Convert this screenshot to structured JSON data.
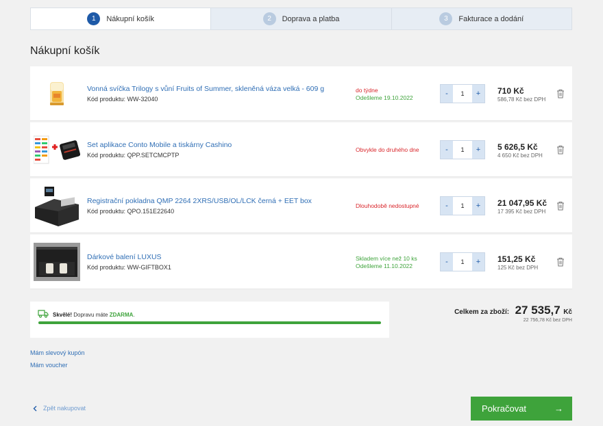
{
  "steps": [
    {
      "num": "1",
      "label": "Nákupní košík"
    },
    {
      "num": "2",
      "label": "Doprava a platba"
    },
    {
      "num": "3",
      "label": "Fakturace a dodání"
    }
  ],
  "page_title": "Nákupní košík",
  "items": [
    {
      "name": "Vonná svíčka Trilogy s vůní Fruits of Summer, skleněná váza velká - 609 g",
      "code": "Kód produktu: WW-32040",
      "avail_1": "do týdne",
      "avail_2": "Odešleme 19.10.2022",
      "qty": "1",
      "price": "710 Kč",
      "price_sub": "586,78 Kč bez DPH"
    },
    {
      "name": "Set aplikace Conto Mobile a tiskárny Cashino",
      "code": "Kód produktu: QPP.SETCMCPTP",
      "avail_1": "Obvykle do druhého dne",
      "qty": "1",
      "price": "5 626,5 Kč",
      "price_sub": "4 650 Kč bez DPH"
    },
    {
      "name": "Registrační pokladna QMP 2264 2XRS/USB/OL/LCK černá + EET box",
      "code": "Kód produktu: QPO.151E22640",
      "avail_1": "Dlouhodobě nedostupné",
      "qty": "1",
      "price": "21 047,95 Kč",
      "price_sub": "17 395 Kč bez DPH"
    },
    {
      "name": "Dárkové balení LUXUS",
      "code": "Kód produktu: WW-GIFTBOX1",
      "avail_1": "Skladem více než 10 ks",
      "avail_2": "Odešleme 11.10.2022",
      "qty": "1",
      "price": "151,25 Kč",
      "price_sub": "125 Kč bez DPH"
    }
  ],
  "qty_minus": "-",
  "qty_plus": "+",
  "shipping": {
    "great": "Skvělé!",
    "text": " Dopravu máte ",
    "free": "ZDARMA",
    "dot": ".",
    "progress_fraction": 1.0
  },
  "total": {
    "label": "Celkem za zboží:",
    "value": "27 535,7",
    "currency": "Kč",
    "sub": "22 756,78 Kč bez DPH"
  },
  "links": {
    "coupon": "Mám slevový kupón",
    "voucher": "Mám voucher"
  },
  "back_label": "Zpět nakupovat",
  "continue_label": "Pokračovat",
  "continue_arrow": "→",
  "colors": {
    "brand_blue": "#1e5aa8",
    "link_blue": "#2f6eb5",
    "green": "#3ea33b",
    "red": "#d9262b"
  }
}
